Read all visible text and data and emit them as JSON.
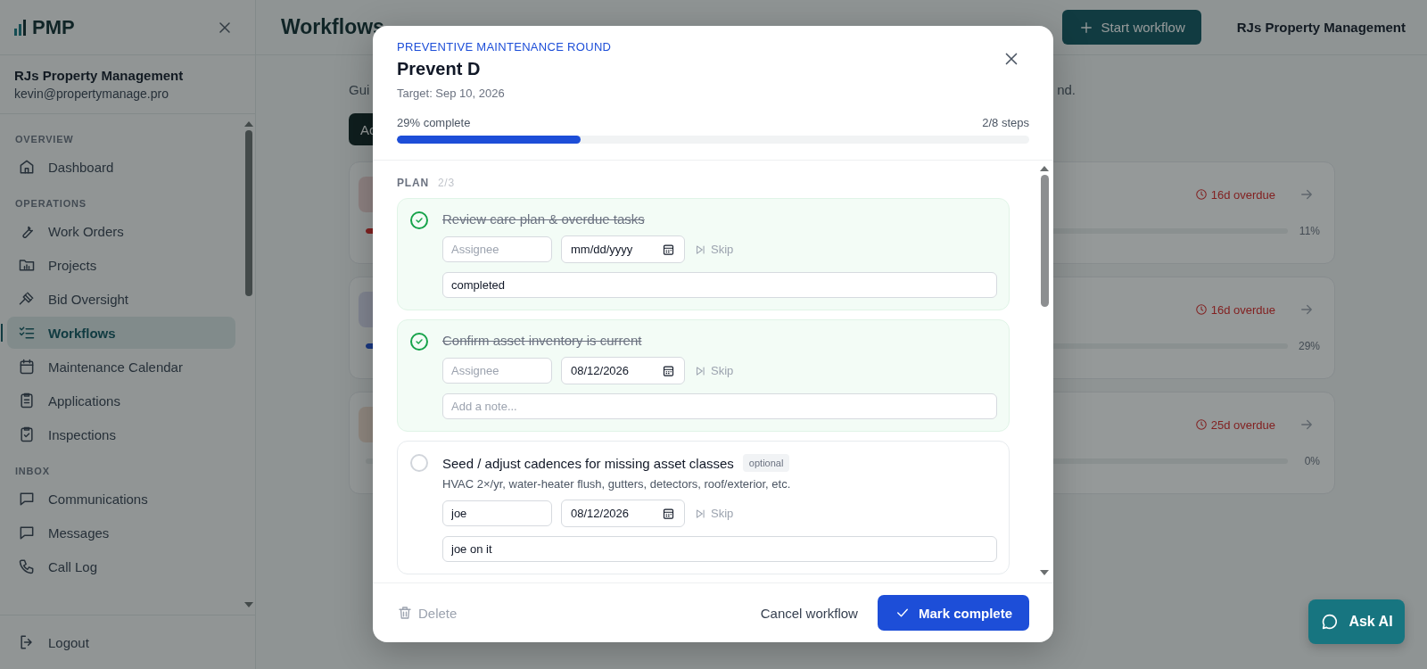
{
  "sidebar": {
    "logo": "PMP",
    "org_name": "RJs Property Management",
    "email": "kevin@propertymanage.pro",
    "sections": [
      {
        "title": "OVERVIEW",
        "items": [
          {
            "label": "Dashboard",
            "selected": false
          }
        ]
      },
      {
        "title": "OPERATIONS",
        "items": [
          {
            "label": "Work Orders",
            "selected": false
          },
          {
            "label": "Projects",
            "selected": false
          },
          {
            "label": "Bid Oversight",
            "selected": false
          },
          {
            "label": "Workflows",
            "selected": true
          },
          {
            "label": "Maintenance Calendar",
            "selected": false
          },
          {
            "label": "Applications",
            "selected": false
          },
          {
            "label": "Inspections",
            "selected": false
          }
        ]
      },
      {
        "title": "INBOX",
        "items": [
          {
            "label": "Communications",
            "selected": false
          },
          {
            "label": "Messages",
            "selected": false
          },
          {
            "label": "Call Log",
            "selected": false
          }
        ]
      }
    ],
    "logout": "Logout"
  },
  "header": {
    "title": "Workflows",
    "start_button": "Start workflow",
    "org_name": "RJs Property Management"
  },
  "intro": {
    "text_start": "Gui",
    "text_end": "nd."
  },
  "tab": "Ac",
  "cards": [
    {
      "status": "16d overdue",
      "percent": "11%",
      "level": 0.11,
      "color": "#822221"
    },
    {
      "status": "16d overdue",
      "percent": "29%",
      "level": 0.29,
      "color": "#193883"
    },
    {
      "status": "25d overdue",
      "percent": "0%",
      "level": 0
    }
  ],
  "modal": {
    "kicker": "PREVENTIVE MAINTENANCE ROUND",
    "title": "Prevent D",
    "target": "Target: Sep 10, 2026",
    "progress_label": "29% complete",
    "steps_count": "2/8 steps",
    "level": 0.29,
    "section": {
      "title": "PLAN",
      "count": "2/3"
    },
    "steps": [
      {
        "title": "Review care plan & overdue tasks",
        "done": true,
        "assignee_placeholder": "Assignee",
        "date": "mm/dd/yyyy",
        "skip": "Skip",
        "note": "completed"
      },
      {
        "title": "Confirm asset inventory is current",
        "done": true,
        "assignee_placeholder": "Assignee",
        "date": "08/12/2026",
        "skip": "Skip",
        "note_placeholder": "Add a note..."
      },
      {
        "title": "Seed / adjust cadences for missing asset classes",
        "done": false,
        "badge": "optional",
        "description": "HVAC 2×/yr, water-heater flush, gutters, detectors, roof/exterior, etc.",
        "assignee": "joe",
        "date": "08/12/2026",
        "skip": "Skip",
        "note": "joe on it"
      }
    ],
    "delete": "Delete",
    "cancel": "Cancel workflow",
    "complete": "Mark complete"
  },
  "ask_ai": "Ask AI"
}
